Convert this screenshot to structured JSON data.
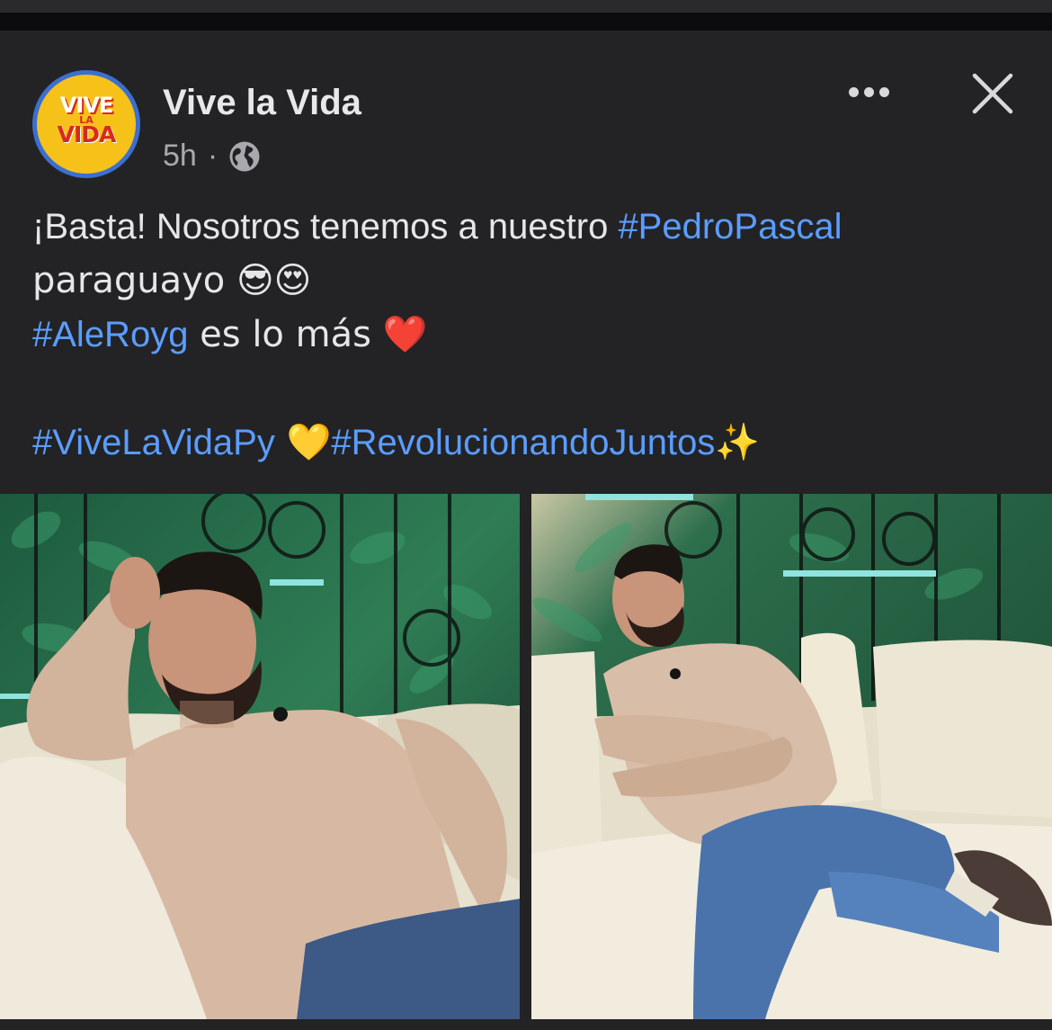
{
  "page": {
    "name": "Vive la Vida",
    "time": "5h",
    "separator": "·",
    "privacy_icon": "globe-icon",
    "more_icon": "more-horizontal-icon",
    "close_icon": "close-icon",
    "logo": {
      "line1": "VIVE",
      "line2": "LA",
      "line3": "VIDA"
    }
  },
  "post": {
    "line1_text": "¡Basta! Nosotros tenemos a nuestro ",
    "line1_tag": "#PedroPascal",
    "line2_text": "paraguayo 😎😍",
    "line3_tag": "#AleRoyg",
    "line3_text": " es lo más ❤️",
    "line5_tag1": "#ViveLaVidaPy",
    "line5_emoji": " 💛",
    "line5_tag2": "#RevolucionandoJuntos",
    "line5_end": "✨"
  },
  "colors": {
    "background": "#232325",
    "hashtag": "#5b9dff",
    "text": "#e6e6e8",
    "avatar_ring": "#3b6fd0",
    "logo_yellow": "#f6c21a",
    "logo_red": "#d72a1f"
  }
}
